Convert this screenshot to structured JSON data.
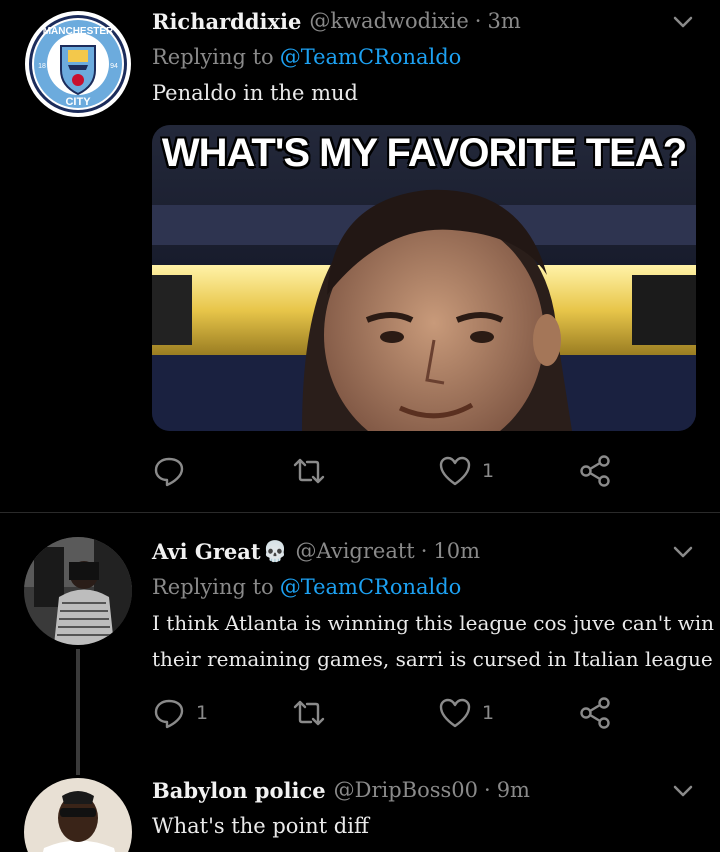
{
  "tweets": [
    {
      "name": "Richarddixie",
      "handle": "@kwadwodixie",
      "time": "3m",
      "replying_prefix": "Replying to",
      "replying_to": "@TeamCRonaldo",
      "text": "Penaldo in the mud",
      "media_caption": "WHAT'S MY FAVORITE TEA?",
      "replies": "",
      "retweets": "",
      "likes": "1"
    },
    {
      "name": "Avi Great",
      "name_emoji": "💀",
      "handle": "@Avigreatt",
      "time": "10m",
      "replying_prefix": "Replying to",
      "replying_to": "@TeamCRonaldo",
      "text_line1": "I think Atlanta is winning this league cos juve can't win all",
      "text_line2": "their remaining games, sarri is cursed in Italian league",
      "replies": "1",
      "retweets": "",
      "likes": "1"
    },
    {
      "name": "Babylon police",
      "handle": "@DripBoss00",
      "time": "9m",
      "text": "What's the point diff"
    }
  ],
  "separator": "·",
  "colors": {
    "background": "#000000",
    "link": "#1da1f2",
    "muted": "#8a8a8a"
  },
  "icons": [
    "reply-icon",
    "retweet-icon",
    "like-icon",
    "share-icon",
    "chevron-down-icon",
    "skull-emoji"
  ]
}
